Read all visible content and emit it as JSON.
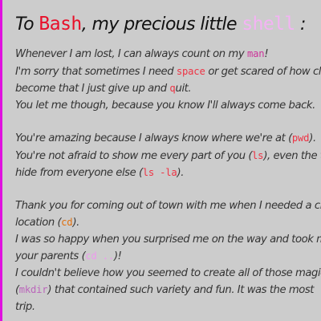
{
  "title": {
    "prefix": "To ",
    "bash": "Bash",
    "middle": ", my precious little ",
    "shell": "shell",
    "suffix": " :"
  },
  "paragraphs": [
    [
      {
        "t": "Whenever I am lost, I can always count on my "
      },
      {
        "t": "man",
        "code": true,
        "color": "c-magenta"
      },
      {
        "t": "!"
      },
      {
        "br": true
      },
      {
        "t": "I'm sorry that sometimes I need "
      },
      {
        "t": "space",
        "code": true,
        "color": "c-red"
      },
      {
        "t": " or get scared of how clo"
      },
      {
        "br": true
      },
      {
        "t": "become that I just give up and "
      },
      {
        "t": "q",
        "code": true,
        "color": "c-red"
      },
      {
        "t": "uit."
      },
      {
        "br": true
      },
      {
        "t": "You let me though, because you know I'll always come back."
      }
    ],
    [
      {
        "t": "You're amazing because I always know where we're at ("
      },
      {
        "t": "pwd",
        "code": true,
        "color": "c-red"
      },
      {
        "t": ")."
      },
      {
        "br": true
      },
      {
        "t": "You're not afraid to show me every part of you ("
      },
      {
        "t": "ls",
        "code": true,
        "color": "c-red"
      },
      {
        "t": "), even the th"
      },
      {
        "br": true
      },
      {
        "t": "hide from everyone else ("
      },
      {
        "t": "ls -la",
        "code": true,
        "color": "c-red"
      },
      {
        "t": ")."
      }
    ],
    [
      {
        "t": "Thank you for coming out of town with me when I needed a ch"
      },
      {
        "br": true
      },
      {
        "t": "location ("
      },
      {
        "t": "cd",
        "code": true,
        "color": "c-orange"
      },
      {
        "t": ")."
      },
      {
        "br": true
      },
      {
        "t": "I was so happy when you surprised me on the way and took m"
      },
      {
        "br": true
      },
      {
        "t": "your parents ("
      },
      {
        "t": "cd ..",
        "code": true,
        "color": "c-lightpink"
      },
      {
        "t": ")!"
      },
      {
        "br": true
      },
      {
        "t": "I couldn't believe how you seemed to create all of those magica"
      },
      {
        "br": true
      },
      {
        "t": "("
      },
      {
        "t": "mkdir",
        "code": true,
        "color": "c-purple"
      },
      {
        "t": ") that contained such variety and fun. It was the most"
      },
      {
        "br": true
      },
      {
        "t": "trip."
      }
    ]
  ],
  "colors": {
    "background": "#cccccc",
    "accent_bar": "#e010e0",
    "bash": "#e8102a",
    "shell": "#f4b3f4",
    "command_red": "#ee3344",
    "command_magenta": "#cc3399",
    "command_orange": "#e07010",
    "command_light_pink": "#ee99ee",
    "command_purple": "#bb66bb"
  }
}
